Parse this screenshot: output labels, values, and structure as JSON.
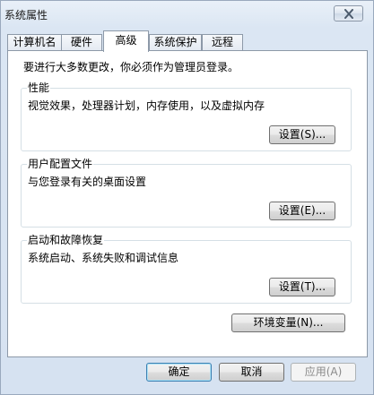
{
  "window": {
    "title": "系统属性"
  },
  "tabs": [
    {
      "label": "计算机名",
      "selected": false
    },
    {
      "label": "硬件",
      "selected": false
    },
    {
      "label": "高级",
      "selected": true
    },
    {
      "label": "系统保护",
      "selected": false
    },
    {
      "label": "远程",
      "selected": false
    }
  ],
  "advanced": {
    "notice": "要进行大多数更改，你必须作为管理员登录。",
    "performance": {
      "title": "性能",
      "description": "视觉效果，处理器计划，内存使用，以及虚拟内存",
      "settings_label": "设置(S)..."
    },
    "user_profiles": {
      "title": "用户配置文件",
      "description": "与您登录有关的桌面设置",
      "settings_label": "设置(E)..."
    },
    "startup_recovery": {
      "title": "启动和故障恢复",
      "description": "系统启动、系统失败和调试信息",
      "settings_label": "设置(T)..."
    },
    "env_vars_label": "环境变量(N)..."
  },
  "footer": {
    "ok_label": "确定",
    "cancel_label": "取消",
    "apply_label": "应用(A)"
  }
}
